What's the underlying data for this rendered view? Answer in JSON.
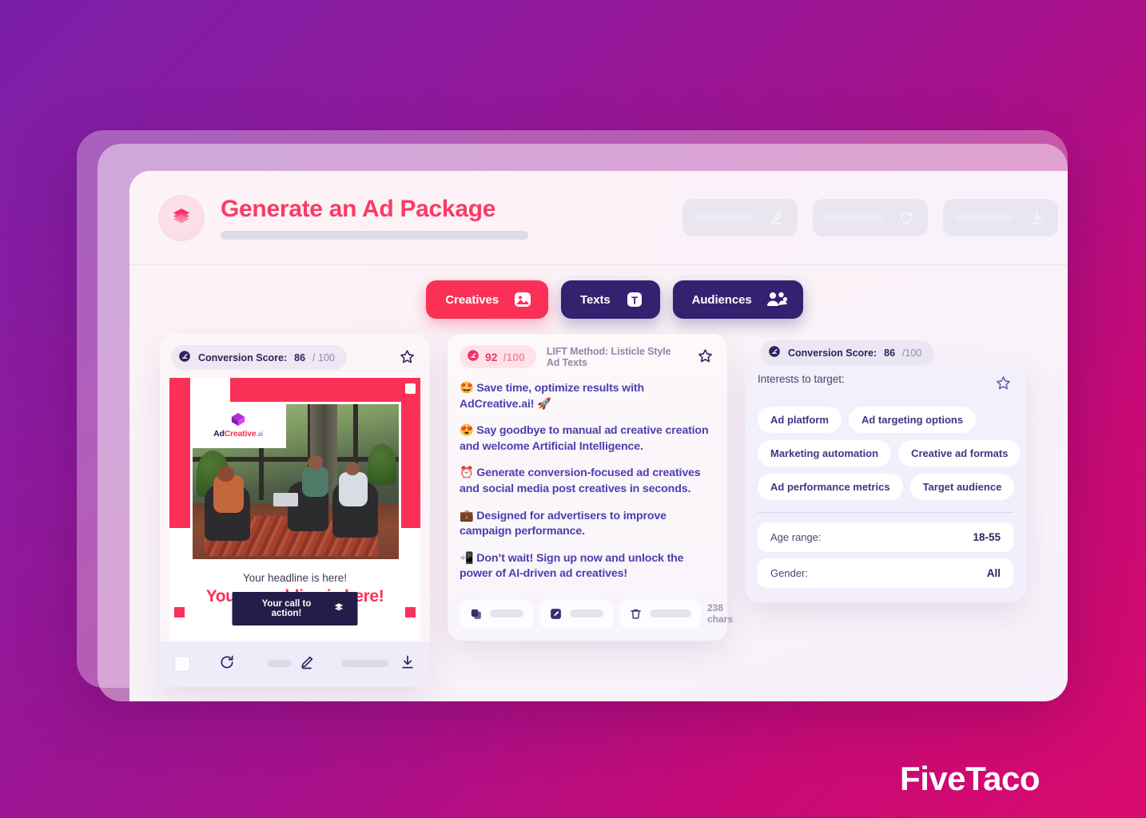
{
  "header": {
    "title": "Generate an Ad Package",
    "brand_icon": "layers-stack-icon",
    "actions": [
      {
        "name": "edit-package-button",
        "icon": "pencil-icon"
      },
      {
        "name": "regenerate-package-button",
        "icon": "refresh-icon"
      },
      {
        "name": "download-package-button",
        "icon": "download-icon"
      }
    ]
  },
  "tabs": [
    {
      "label": "Creatives",
      "icon": "image-icon",
      "active": true
    },
    {
      "label": "Texts",
      "icon": "text-t-icon",
      "active": false
    },
    {
      "label": "Audiences",
      "icon": "people-icon",
      "active": false
    }
  ],
  "creatives": {
    "score_label": "Conversion Score:",
    "score_value": "86",
    "score_max": "/ 100",
    "star_icon": "star-outline-icon",
    "logo": {
      "ad": "Ad",
      "creative": "Creative",
      "ai": ".ai"
    },
    "headline": "Your headline is here!",
    "punchline": "Your punchline is here!",
    "cta": "Your call to action!",
    "cta_icon": "layers-stack-icon",
    "toolbar": {
      "checkbox": "select-creative-checkbox",
      "refresh_icon": "refresh-icon",
      "edit_icon": "pencil-icon",
      "download_icon": "download-icon"
    }
  },
  "texts": {
    "score_value": "92",
    "score_max": "/100",
    "method_label": "LIFT Method: Listicle Style Ad Texts",
    "star_icon": "star-outline-icon",
    "lines": [
      "🤩 Save time, optimize results with AdCreative.ai! 🚀",
      "😍 Say goodbye to manual ad creative creation and welcome Artificial Intelligence.",
      "⏰ Generate conversion-focused ad creatives and social media post creatives in seconds.",
      "💼 Designed for advertisers to improve campaign performance.",
      "📲 Don’t wait! Sign up now and unlock the power of AI-driven ad creatives!"
    ],
    "toolbar": {
      "copy_icon": "copy-icon",
      "edit_icon": "pencil-square-icon",
      "delete_icon": "trash-icon",
      "char_count": "238 chars"
    }
  },
  "audiences": {
    "score_label": "Conversion Score:",
    "score_value": "86",
    "score_max": "/100",
    "interests_label": "Interests to target:",
    "star_icon": "star-outline-icon",
    "tags": [
      [
        "Ad platform",
        "Ad targeting options"
      ],
      [
        "Marketing automation",
        "Creative ad formats"
      ],
      [
        "Ad performance metrics",
        "Target audience"
      ]
    ],
    "fields": [
      {
        "key": "Age range:",
        "value": "18-55"
      },
      {
        "key": "Gender:",
        "value": "All"
      }
    ]
  },
  "watermark": "FiveTaco",
  "colors": {
    "accent_pink": "#fb3056",
    "dark_purple": "#342170",
    "text_purple": "#4a3fb0",
    "bg_gradient_start": "#7b1fa8",
    "bg_gradient_end": "#d80a6e"
  }
}
